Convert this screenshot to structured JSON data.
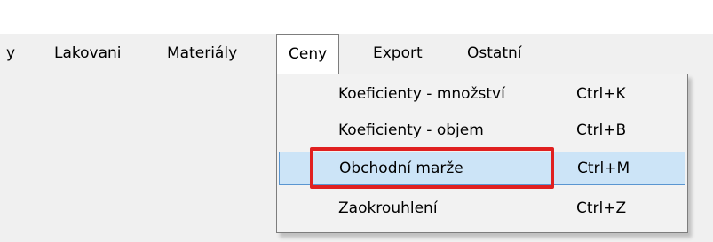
{
  "menubar": {
    "items": [
      {
        "label": "y"
      },
      {
        "label": "Lakovani"
      },
      {
        "label": "Materiály"
      },
      {
        "label": "Ceny"
      },
      {
        "label": "Export"
      },
      {
        "label": "Ostatní"
      }
    ],
    "active_index": 3
  },
  "dropdown": {
    "items": [
      {
        "label": "Koeficienty - množství",
        "shortcut": "Ctrl+K"
      },
      {
        "label": "Koeficienty - objem",
        "shortcut": "Ctrl+B"
      },
      {
        "label": "Obchodní marže",
        "shortcut": "Ctrl+M"
      },
      {
        "label": "Zaokrouhlení",
        "shortcut": "Ctrl+Z"
      }
    ],
    "selected_index": 2
  },
  "colors": {
    "highlight_border": "#e02020",
    "selected_fill": "#cce4f7",
    "selected_border": "#5a96d1"
  }
}
